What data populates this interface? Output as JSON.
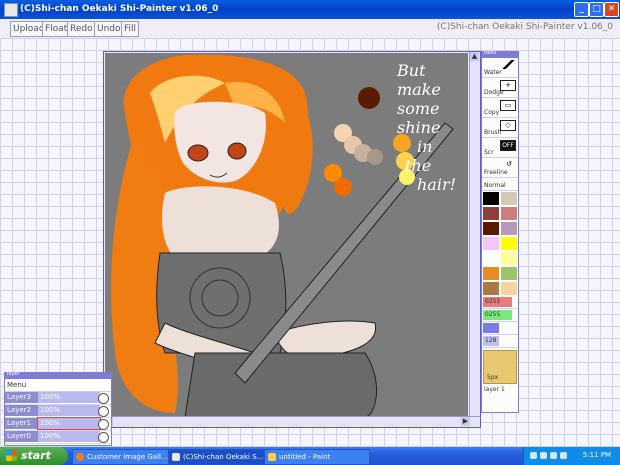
{
  "window": {
    "title": "(C)Shi-chan Oekaki Shi-Painter v1.06_0",
    "controls": {
      "minimize": "_",
      "maximize": "□",
      "close": "✕"
    }
  },
  "toolbar": {
    "buttons": [
      "Upload",
      "Float",
      "Redo",
      "Undo",
      "Fill"
    ],
    "right_title": "(C)Shi-chan Oekaki Shi-Painter v1.06_0"
  },
  "canvas": {
    "handwritten_text": [
      "But",
      "make",
      "some",
      "shine",
      "in",
      "the",
      "hair!"
    ]
  },
  "tool_panel": {
    "header": "tools",
    "tools": [
      {
        "label": "Water",
        "icon": "pencil-icon"
      },
      {
        "label": "Dodge",
        "icon": "plus-icon"
      },
      {
        "label": "Copy",
        "icon": "copy-icon"
      },
      {
        "label": "Brush",
        "icon": "eraser-icon"
      },
      {
        "label": "Scr",
        "icon": "off-toggle-icon",
        "icon_text": "OFF"
      },
      {
        "label": "Freeline",
        "icon": "lasso-icon"
      }
    ],
    "mode_label": "Normal",
    "swatches": [
      "#000000",
      "#d4c9b5",
      "#8b3f3f",
      "#ca7e7e",
      "#5b1a00",
      "#b89ab8",
      "#f7c4f7",
      "#ffff00",
      "#ffffff",
      "#ffff99",
      "#e88b20",
      "#98c56e",
      "#aa7a42",
      "#f8d39e"
    ],
    "sliders": [
      {
        "label": "0255",
        "color": "#e87b7b",
        "level": 0.9
      },
      {
        "label": "0255",
        "color": "#7be87b",
        "level": 0.9
      },
      {
        "label": "",
        "color": "#7b7be8",
        "level": 0.5
      },
      {
        "label": "128",
        "color": "#c0c0f0",
        "level": 0.5
      }
    ],
    "size_label": "5px",
    "current_layer": "layer 1"
  },
  "layer_panel": {
    "header": "layer",
    "menu_label": "Menu",
    "layers": [
      {
        "name": "Layer3",
        "opacity": "100%",
        "active": false
      },
      {
        "name": "Layer2",
        "opacity": "100%",
        "active": false
      },
      {
        "name": "Layer1",
        "opacity": "100%",
        "active": true
      },
      {
        "name": "Layer0",
        "opacity": "100%",
        "active": false
      }
    ]
  },
  "taskbar": {
    "start_label": "start",
    "tasks": [
      {
        "label": "Customer Image Gall...",
        "icon": "firefox-icon",
        "active": false
      },
      {
        "label": "(C)Shi-chan Oekaki S...",
        "icon": "java-icon",
        "active": true
      },
      {
        "label": "untitled - Paint",
        "icon": "paint-icon",
        "active": false
      }
    ],
    "clock": "5:11 PM"
  },
  "colors": {
    "titlebar": "#0441c6",
    "canvas_bg": "#7a7a7a",
    "hair": "#f07a10",
    "panel_border": "#7d7dd5"
  }
}
